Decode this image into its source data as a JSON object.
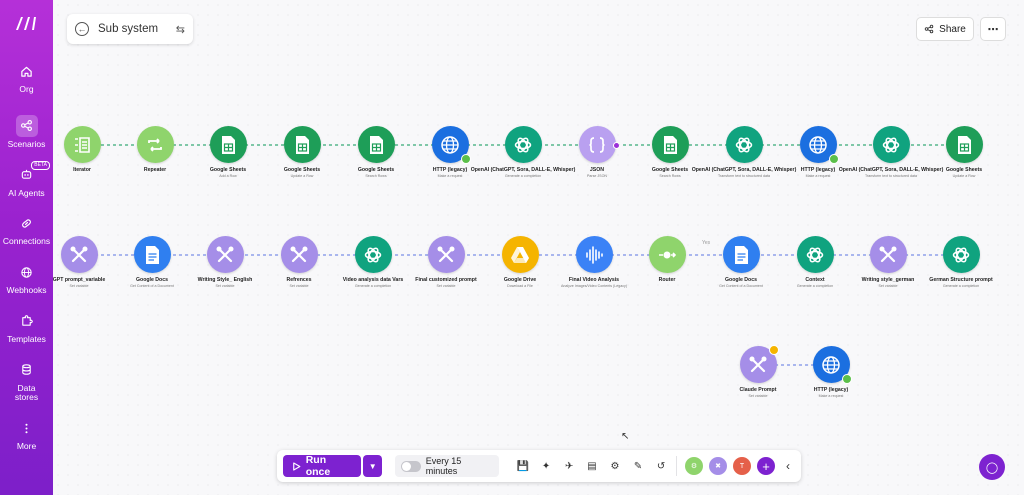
{
  "sidebar": {
    "items": [
      {
        "label": "Org",
        "icon": "home-icon"
      },
      {
        "label": "Scenarios",
        "icon": "share-nodes-icon",
        "active": true
      },
      {
        "label": "AI Agents",
        "icon": "ai-agent-icon",
        "badge": "BETA"
      },
      {
        "label": "Connections",
        "icon": "link-icon"
      },
      {
        "label": "Webhooks",
        "icon": "globe-icon"
      },
      {
        "label": "Templates",
        "icon": "puzzle-icon"
      },
      {
        "label": "Data stores",
        "icon": "database-icon"
      },
      {
        "label": "More",
        "icon": "dots-vertical-icon"
      }
    ]
  },
  "header": {
    "title": "Sub system",
    "share_label": "Share",
    "more_label": "⋯"
  },
  "modules": {
    "row1": [
      {
        "name": "Iterator",
        "sub": "",
        "color": "#8fd46c"
      },
      {
        "name": "Repeater",
        "sub": "",
        "color": "#8fd46c"
      },
      {
        "name": "Google Sheets",
        "sub": "Add a Row",
        "color": "#1e9e58"
      },
      {
        "name": "Google Sheets",
        "sub": "Update a Row",
        "color": "#1e9e58"
      },
      {
        "name": "Google Sheets",
        "sub": "Search Rows",
        "color": "#1e9e58"
      },
      {
        "name": "HTTP (legacy)",
        "sub": "Make a request",
        "color": "#1b6fe0"
      },
      {
        "name": "OpenAI (ChatGPT, Sora, DALL-E, Whisper)",
        "sub": "Generate a completion",
        "color": "#10a37f"
      },
      {
        "name": "JSON",
        "sub": "Parse JSON",
        "color": "#b9a0f0"
      },
      {
        "name": "Google Sheets",
        "sub": "Search Rows",
        "color": "#1e9e58"
      },
      {
        "name": "OpenAI (ChatGPT, Sora, DALL-E, Whisper)",
        "sub": "Transform text to structured data",
        "color": "#10a37f"
      },
      {
        "name": "HTTP (legacy)",
        "sub": "Make a request",
        "color": "#1b6fe0"
      },
      {
        "name": "OpenAI (ChatGPT, Sora, DALL-E, Whisper)",
        "sub": "Transform text to structured data",
        "color": "#10a37f"
      },
      {
        "name": "Google Sheets",
        "sub": "Update a Row",
        "color": "#1e9e58"
      }
    ],
    "row2": [
      {
        "name": "GPT prompt_variable",
        "sub": "Set variable",
        "color": "#a58ee8"
      },
      {
        "name": "Google Docs",
        "sub": "Get Content of a Document",
        "color": "#2f7ff0"
      },
      {
        "name": "Writing Style_ English",
        "sub": "Set variable",
        "color": "#a58ee8"
      },
      {
        "name": "Refrences",
        "sub": "Set variable",
        "color": "#a58ee8"
      },
      {
        "name": "Video analysis data Vars",
        "sub": "Generate a completion",
        "color": "#10a37f"
      },
      {
        "name": "Final customized prompt",
        "sub": "Set variable",
        "color": "#a58ee8"
      },
      {
        "name": "Google Drive",
        "sub": "Download a File",
        "color": "#f5b400"
      },
      {
        "name": "Final Video Analysis",
        "sub": "Analyze Images/Video Contents (Legacy)",
        "color": "#3b82f6"
      },
      {
        "name": "Router",
        "sub": "",
        "color": "#8fd46c"
      },
      {
        "name": "Google Docs",
        "sub": "Get Content of a Document",
        "color": "#2f7ff0"
      },
      {
        "name": "Context",
        "sub": "Generate a completion",
        "color": "#10a37f"
      },
      {
        "name": "Writing style_german",
        "sub": "Set variable",
        "color": "#a58ee8"
      },
      {
        "name": "German Structure prompt",
        "sub": "Generate a completion",
        "color": "#10a37f"
      }
    ],
    "row3": [
      {
        "name": "Claude Prompt",
        "sub": "Set variable",
        "color": "#a58ee8"
      },
      {
        "name": "HTTP (legacy)",
        "sub": "Make a request",
        "color": "#1b6fe0"
      }
    ],
    "router_filter_label": "Yes"
  },
  "toolbar": {
    "run_label": "Run once",
    "schedule_label": "Every 15 minutes"
  },
  "colors": {
    "accent": "#7d22d0",
    "sidebar_top": "#b530d8",
    "sidebar_bottom": "#7d1fc9"
  }
}
